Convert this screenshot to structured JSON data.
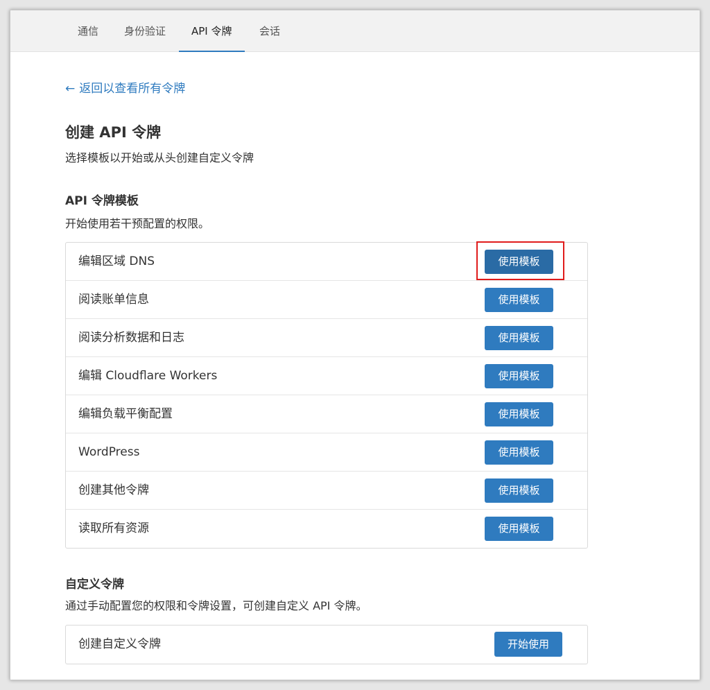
{
  "tabs": [
    {
      "label": "通信",
      "active": false
    },
    {
      "label": "身份验证",
      "active": false
    },
    {
      "label": "API 令牌",
      "active": true
    },
    {
      "label": "会话",
      "active": false
    }
  ],
  "back_link": {
    "arrow": "←",
    "label": "返回以查看所有令牌"
  },
  "page": {
    "title": "创建 API 令牌",
    "subtitle": "选择模板以开始或从头创建自定义令牌"
  },
  "templates": {
    "title": "API 令牌模板",
    "description": "开始使用若干预配置的权限。",
    "button_label": "使用模板",
    "items": [
      {
        "label": "编辑区域 DNS",
        "highlighted": true
      },
      {
        "label": "阅读账单信息",
        "highlighted": false
      },
      {
        "label": "阅读分析数据和日志",
        "highlighted": false
      },
      {
        "label": "编辑 Cloudflare Workers",
        "highlighted": false
      },
      {
        "label": "编辑负载平衡配置",
        "highlighted": false
      },
      {
        "label": "WordPress",
        "highlighted": false
      },
      {
        "label": "创建其他令牌",
        "highlighted": false
      },
      {
        "label": "读取所有资源",
        "highlighted": false
      }
    ]
  },
  "custom": {
    "title": "自定义令牌",
    "description": "通过手动配置您的权限和令牌设置，可创建自定义 API 令牌。",
    "item_label": "创建自定义令牌",
    "button_label": "开始使用"
  },
  "colors": {
    "accent": "#2f7bbf",
    "highlight": "#e01b1b"
  }
}
